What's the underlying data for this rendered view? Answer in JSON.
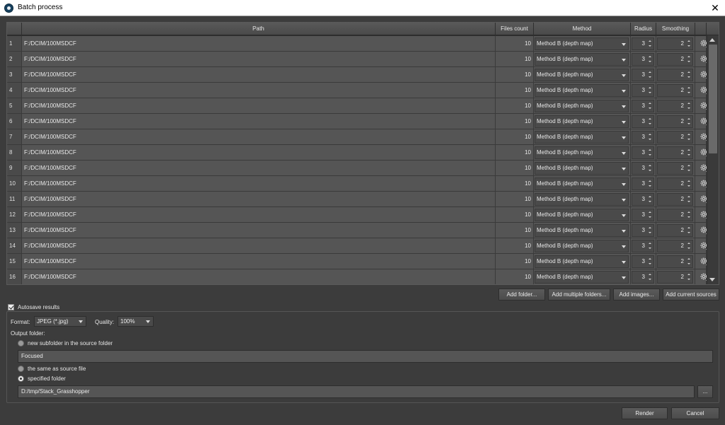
{
  "window": {
    "title": "Batch process",
    "close_glyph": "✕"
  },
  "table": {
    "headers": [
      "Path",
      "Files count",
      "Method",
      "Radius",
      "Smoothing"
    ],
    "rows": [
      {
        "index": "1",
        "path": "F:/DCIM/100MSDCF",
        "files_count": "10",
        "method": "Method B (depth map)",
        "radius": "3",
        "smoothing": "2"
      },
      {
        "index": "2",
        "path": "F:/DCIM/100MSDCF",
        "files_count": "10",
        "method": "Method B (depth map)",
        "radius": "3",
        "smoothing": "2"
      },
      {
        "index": "3",
        "path": "F:/DCIM/100MSDCF",
        "files_count": "10",
        "method": "Method B (depth map)",
        "radius": "3",
        "smoothing": "2"
      },
      {
        "index": "4",
        "path": "F:/DCIM/100MSDCF",
        "files_count": "10",
        "method": "Method B (depth map)",
        "radius": "3",
        "smoothing": "2"
      },
      {
        "index": "5",
        "path": "F:/DCIM/100MSDCF",
        "files_count": "10",
        "method": "Method B (depth map)",
        "radius": "3",
        "smoothing": "2"
      },
      {
        "index": "6",
        "path": "F:/DCIM/100MSDCF",
        "files_count": "10",
        "method": "Method B (depth map)",
        "radius": "3",
        "smoothing": "2"
      },
      {
        "index": "7",
        "path": "F:/DCIM/100MSDCF",
        "files_count": "10",
        "method": "Method B (depth map)",
        "radius": "3",
        "smoothing": "2"
      },
      {
        "index": "8",
        "path": "F:/DCIM/100MSDCF",
        "files_count": "10",
        "method": "Method B (depth map)",
        "radius": "3",
        "smoothing": "2"
      },
      {
        "index": "9",
        "path": "F:/DCIM/100MSDCF",
        "files_count": "10",
        "method": "Method B (depth map)",
        "radius": "3",
        "smoothing": "2"
      },
      {
        "index": "10",
        "path": "F:/DCIM/100MSDCF",
        "files_count": "10",
        "method": "Method B (depth map)",
        "radius": "3",
        "smoothing": "2"
      },
      {
        "index": "11",
        "path": "F:/DCIM/100MSDCF",
        "files_count": "10",
        "method": "Method B (depth map)",
        "radius": "3",
        "smoothing": "2"
      },
      {
        "index": "12",
        "path": "F:/DCIM/100MSDCF",
        "files_count": "10",
        "method": "Method B (depth map)",
        "radius": "3",
        "smoothing": "2"
      },
      {
        "index": "13",
        "path": "F:/DCIM/100MSDCF",
        "files_count": "10",
        "method": "Method B (depth map)",
        "radius": "3",
        "smoothing": "2"
      },
      {
        "index": "14",
        "path": "F:/DCIM/100MSDCF",
        "files_count": "10",
        "method": "Method B (depth map)",
        "radius": "3",
        "smoothing": "2"
      },
      {
        "index": "15",
        "path": "F:/DCIM/100MSDCF",
        "files_count": "10",
        "method": "Method B (depth map)",
        "radius": "3",
        "smoothing": "2"
      },
      {
        "index": "16",
        "path": "F:/DCIM/100MSDCF",
        "files_count": "10",
        "method": "Method B (depth map)",
        "radius": "3",
        "smoothing": "2"
      }
    ],
    "row_icon": "gear-icon"
  },
  "actions": {
    "add_folder": "Add folder...",
    "add_multiple_folders": "Add multiple folders...",
    "add_images": "Add images...",
    "add_current_sources": "Add current sources"
  },
  "autosave": {
    "label": "Autosave results",
    "checked": true,
    "format_label": "Format:",
    "format_value": "JPEG (*.jpg)",
    "quality_label": "Quality:",
    "quality_value": "100%",
    "output_folder_label": "Output folder:",
    "option_subfolder": "new subfolder in the source folder",
    "subfolder_value": "Focused",
    "option_same": "the same as source file",
    "option_specified": "specified folder",
    "selected_option": "specified folder",
    "specified_value": "D:/tmp/Stack_Grasshopper",
    "browse_label": "..."
  },
  "footer": {
    "render_label": "Render",
    "cancel_label": "Cancel"
  },
  "colors": {
    "background": "#3c3c3c",
    "cell": "#555555",
    "header": "#4a4a4a"
  }
}
